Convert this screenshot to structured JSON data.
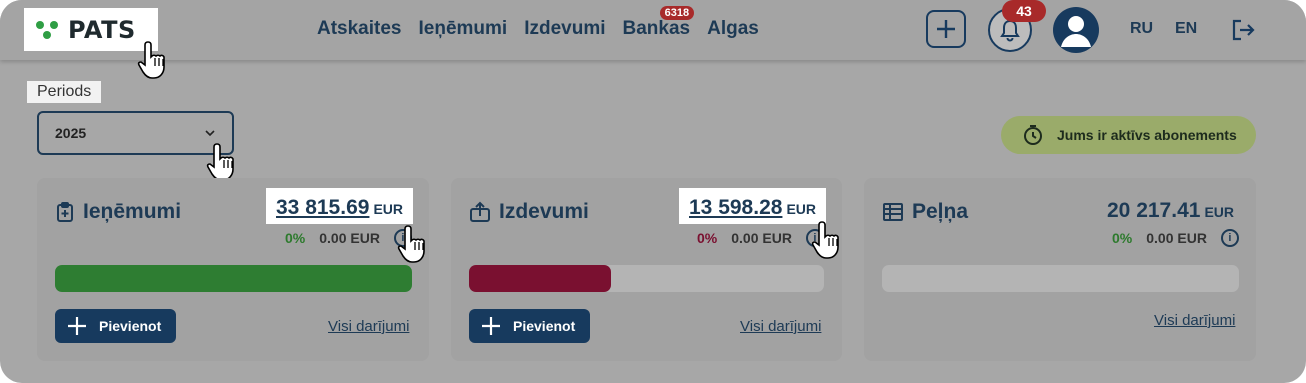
{
  "brand": {
    "name": "PATS",
    "dot_color": "#2f9e44"
  },
  "nav": {
    "items": [
      {
        "label": "Atskaites"
      },
      {
        "label": "Ieņēmumi"
      },
      {
        "label": "Izdevumi"
      },
      {
        "label": "Bankas",
        "badge": "6318"
      },
      {
        "label": "Algas"
      }
    ]
  },
  "header": {
    "notifications_count": "43",
    "languages": [
      "RU",
      "EN"
    ]
  },
  "period": {
    "label": "Periods",
    "selected": "2025"
  },
  "subscription": {
    "text": "Jums ir aktīvs abonements"
  },
  "cards": {
    "income": {
      "title": "Ieņēmumi",
      "amount": "33 815.69",
      "currency": "EUR",
      "change_pct": "0%",
      "change_value": "0.00 EUR",
      "bar_fill": 1.0,
      "bar_color": "#2e7d32",
      "add_label": "Pievienot",
      "all_link": "Visi darījumi"
    },
    "expenses": {
      "title": "Izdevumi",
      "amount": "13 598.28",
      "currency": "EUR",
      "change_pct": "0%",
      "change_value": "0.00 EUR",
      "bar_fill": 0.4,
      "bar_color": "#7a1030",
      "add_label": "Pievienot",
      "all_link": "Visi darījumi"
    },
    "profit": {
      "title": "Peļņa",
      "amount": "20 217.41",
      "currency": "EUR",
      "change_pct": "0%",
      "change_value": "0.00 EUR",
      "bar_fill": 0.0,
      "all_link": "Visi darījumi"
    }
  }
}
